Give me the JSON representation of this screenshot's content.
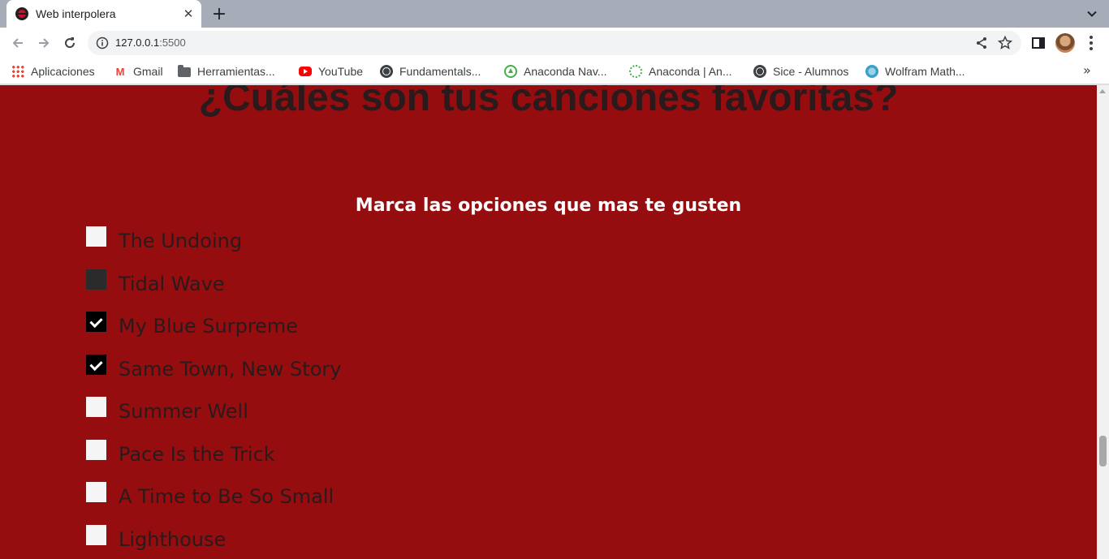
{
  "browser": {
    "tab": {
      "title": "Web interpolera",
      "close_glyph": "✕"
    },
    "new_tab_glyph": "+",
    "address": {
      "host": "127.0.0.1",
      "port": ":5500"
    }
  },
  "bookmarks": [
    {
      "label": "Aplicaciones",
      "icon": "apps-grid-icon"
    },
    {
      "label": "Gmail",
      "icon": "gmail-icon"
    },
    {
      "label": "Herramientas...",
      "icon": "folder-icon"
    },
    {
      "label": "YouTube",
      "icon": "youtube-icon"
    },
    {
      "label": "Fundamentals...",
      "icon": "globe-icon"
    },
    {
      "label": "Anaconda Nav...",
      "icon": "anaconda-icon"
    },
    {
      "label": "Anaconda | An...",
      "icon": "anaconda-ring-icon"
    },
    {
      "label": "Sice - Alumnos",
      "icon": "globe-icon"
    },
    {
      "label": "Wolfram Math...",
      "icon": "wolfram-icon"
    }
  ],
  "bookmarks_overflow": "»",
  "page": {
    "heading": "¿Cuáles son tus canciones favoritas?",
    "subheading": "Marca las opciones que mas te gusten",
    "options": [
      {
        "label": "The Undoing",
        "checked": false
      },
      {
        "label": "Tidal Wave",
        "checked": false,
        "hovered": true
      },
      {
        "label": "My Blue Surpreme",
        "checked": true
      },
      {
        "label": "Same Town, New Story",
        "checked": true
      },
      {
        "label": "Summer Well",
        "checked": false
      },
      {
        "label": "Pace Is the Trick",
        "checked": false
      },
      {
        "label": "A Time to Be So Small",
        "checked": false
      },
      {
        "label": "Lighthouse",
        "checked": false
      }
    ]
  },
  "colors": {
    "page_background": "#960d0f",
    "heading_text": "#2a1a1b",
    "subheading_text": "#ffffff"
  }
}
